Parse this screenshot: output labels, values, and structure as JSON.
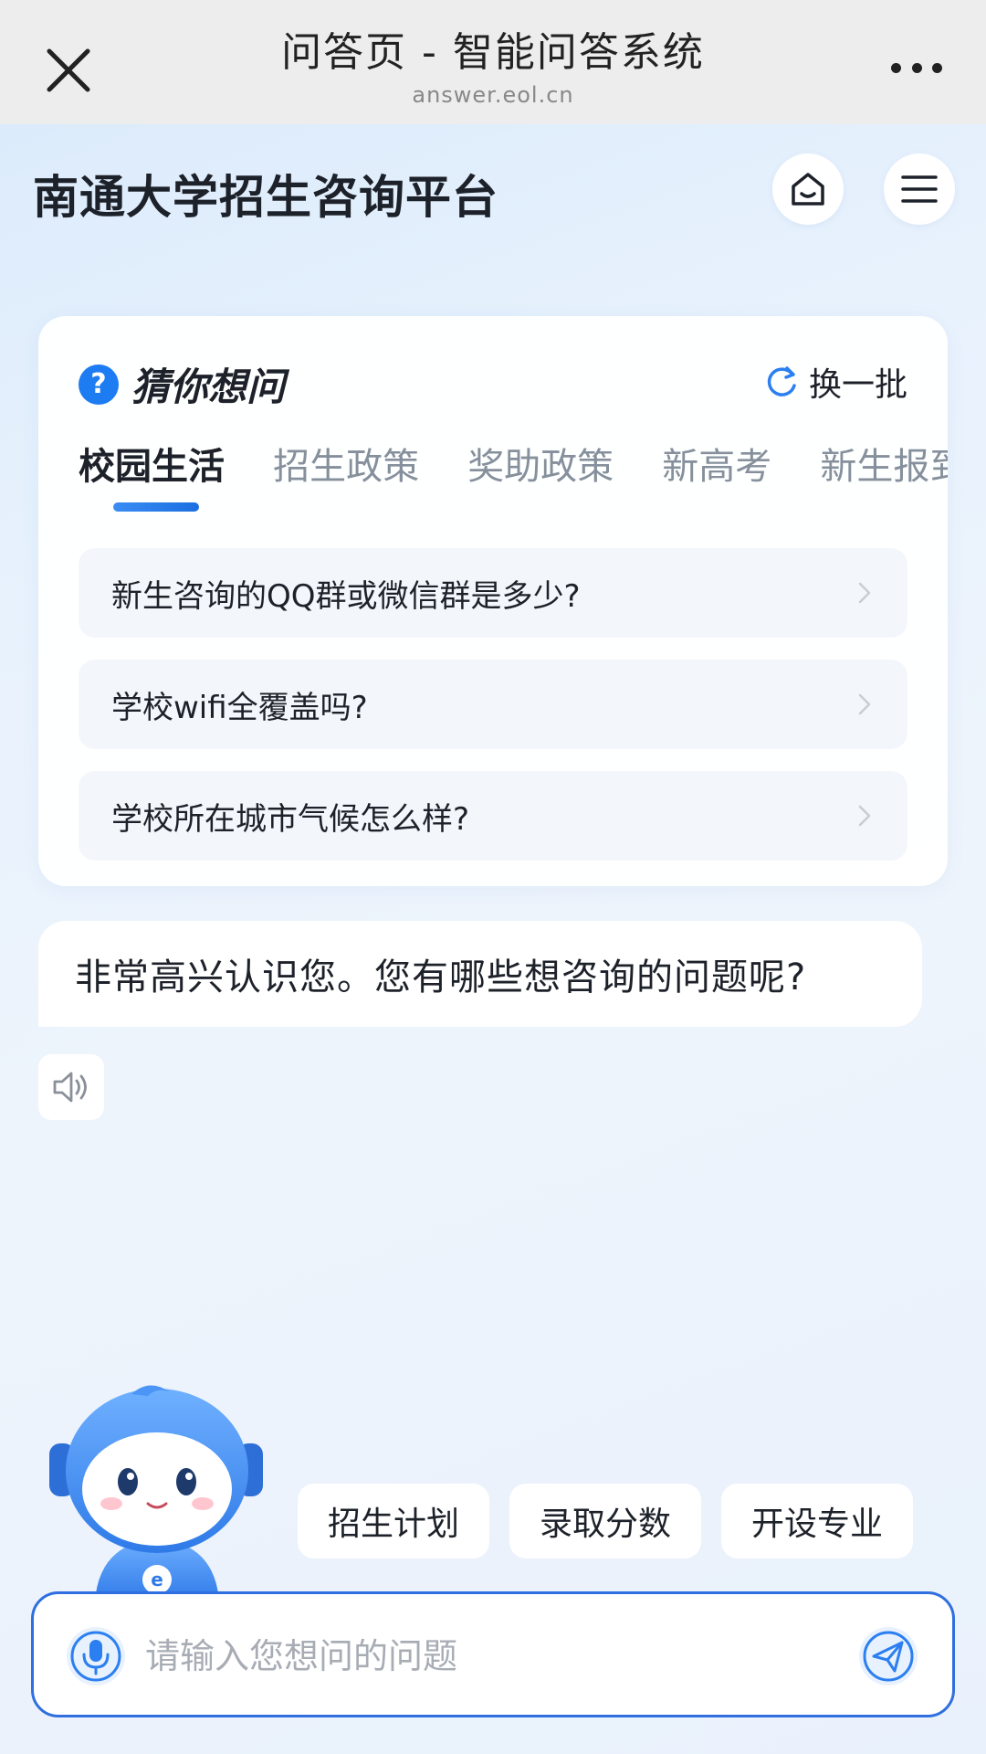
{
  "browser": {
    "title": "问答页 - 智能问答系统",
    "url": "answer.eol.cn"
  },
  "header": {
    "title": "南通大学招生咨询平台"
  },
  "suggest": {
    "badge": "?",
    "title": "猜你想问",
    "refresh_label": "换一批",
    "tabs": [
      "校园生活",
      "招生政策",
      "奖助政策",
      "新高考",
      "新生报到"
    ],
    "active_tab": 0,
    "questions": [
      "新生咨询的QQ群或微信群是多少?",
      "学校wifi全覆盖吗?",
      "学校所在城市气候怎么样?"
    ]
  },
  "greeting": {
    "text": "非常高兴认识您。您有哪些想咨询的问题呢?"
  },
  "quick_chips": [
    "招生计划",
    "录取分数",
    "开设专业"
  ],
  "input": {
    "placeholder": "请输入您想问的问题",
    "value": ""
  },
  "colors": {
    "accent": "#1d7cf2",
    "input_border": "#2f6fe0",
    "mascot": "#3d8ef0"
  },
  "icons": {
    "close": "close-icon",
    "more": "more-icon",
    "home": "home-icon",
    "menu": "menu-icon",
    "refresh": "refresh-icon",
    "chevron": "chevron-right-icon",
    "speaker": "speaker-icon",
    "mic": "microphone-icon",
    "send": "send-icon"
  }
}
